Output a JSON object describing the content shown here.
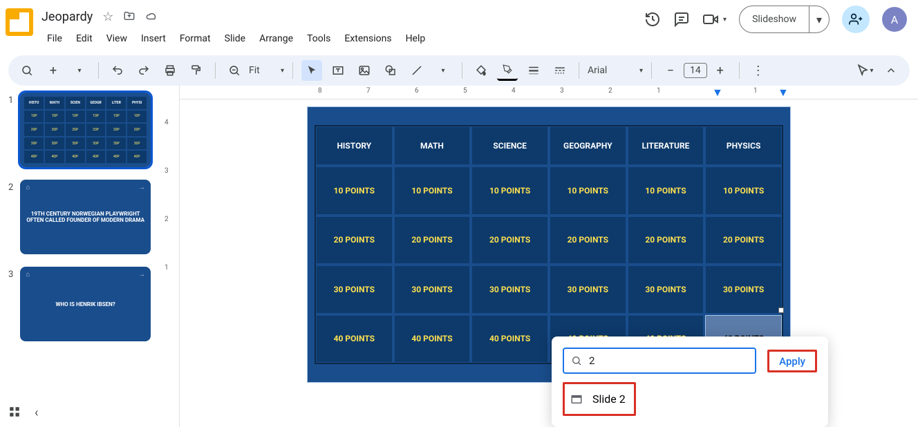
{
  "header": {
    "title": "Jeopardy",
    "menu": [
      "File",
      "Edit",
      "View",
      "Insert",
      "Format",
      "Slide",
      "Arrange",
      "Tools",
      "Extensions",
      "Help"
    ],
    "slideshow_label": "Slideshow",
    "avatar_initial": "A"
  },
  "toolbar": {
    "zoom_label": "Fit",
    "font_family": "Arial",
    "font_size": "14"
  },
  "ruler": {
    "horizontal": [
      "8",
      "7",
      "6",
      "5",
      "4",
      "3",
      "2",
      "1",
      "1"
    ],
    "vertical": [
      "4",
      "3",
      "2",
      "1"
    ]
  },
  "slides": {
    "thumbs": [
      {
        "num": "1",
        "type": "grid"
      },
      {
        "num": "2",
        "type": "text",
        "text": "19TH CENTURY NORWEGIAN PLAYWRIGHT OFTEN CALLED FOUNDER OF MODERN DRAMA"
      },
      {
        "num": "3",
        "type": "text",
        "text": "WHO IS HENRIK IBSEN?"
      }
    ]
  },
  "jeopardy": {
    "categories": [
      "HISTORY",
      "MATH",
      "SCIENCE",
      "GEOGRAPHY",
      "LITERATURE",
      "PHYSICS"
    ],
    "rows": [
      [
        "10 POINTS",
        "10 POINTS",
        "10 POINTS",
        "10 POINTS",
        "10 POINTS",
        "10 POINTS"
      ],
      [
        "20 POINTS",
        "20 POINTS",
        "20 POINTS",
        "20 POINTS",
        "20 POINTS",
        "20 POINTS"
      ],
      [
        "30 POINTS",
        "30 POINTS",
        "30 POINTS",
        "30 POINTS",
        "30 POINTS",
        "30 POINTS"
      ],
      [
        "40 POINTS",
        "40 POINTS",
        "40 POINTS",
        "40 POINTS",
        "40 POINTS",
        "40 POINTS"
      ]
    ],
    "selected_cell": {
      "row": 3,
      "col": 5
    }
  },
  "link_popup": {
    "search_value": "2",
    "apply_label": "Apply",
    "result_label": "Slide 2"
  },
  "chart_data": null
}
